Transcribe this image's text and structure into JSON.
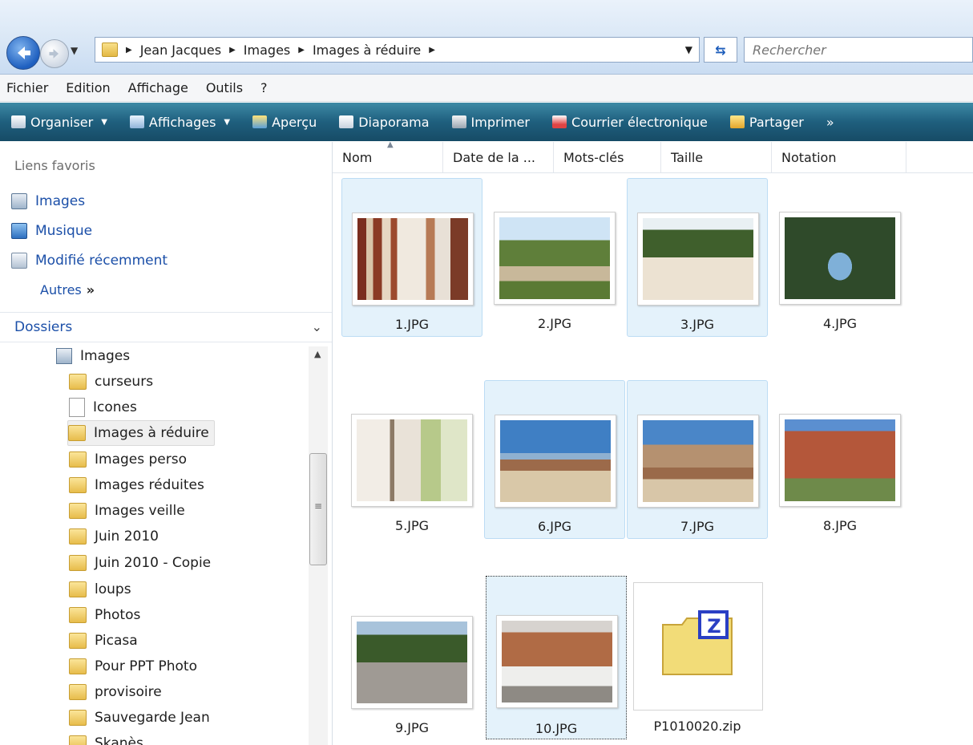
{
  "address": {
    "crumbs": [
      "Jean Jacques",
      "Images",
      "Images à réduire"
    ],
    "search_placeholder": "Rechercher"
  },
  "menu": [
    "Fichier",
    "Edition",
    "Affichage",
    "Outils",
    "?"
  ],
  "toolbar": {
    "organiser": "Organiser",
    "affichages": "Affichages",
    "apercu": "Aperçu",
    "diaporama": "Diaporama",
    "imprimer": "Imprimer",
    "courrier": "Courrier électronique",
    "partager": "Partager",
    "more": "»"
  },
  "favorites": {
    "title": "Liens favoris",
    "items": [
      "Images",
      "Musique",
      "Modifié récemment"
    ],
    "others": "Autres",
    "others_more": "»"
  },
  "folders": {
    "title": "Dossiers",
    "root": "Images",
    "items": [
      "curseurs",
      "Icones",
      "Images à réduire",
      "Images perso",
      "Images réduites",
      "Images veille",
      "Juin 2010",
      "Juin 2010 - Copie",
      "loups",
      "Photos",
      "Picasa",
      "Pour PPT Photo",
      "provisoire",
      "Sauvegarde Jean",
      "Skanès"
    ],
    "selected": "Images à réduire"
  },
  "columns": [
    "Nom",
    "Date de la ...",
    "Mots-clés",
    "Taille",
    "Notation"
  ],
  "files": [
    {
      "name": "1.JPG",
      "selected": true
    },
    {
      "name": "2.JPG",
      "selected": false
    },
    {
      "name": "3.JPG",
      "selected": true
    },
    {
      "name": "4.JPG",
      "selected": false
    },
    {
      "name": "5.JPG",
      "selected": false
    },
    {
      "name": "6.JPG",
      "selected": true
    },
    {
      "name": "7.JPG",
      "selected": true
    },
    {
      "name": "8.JPG",
      "selected": false
    },
    {
      "name": "9.JPG",
      "selected": false
    },
    {
      "name": "10.JPG",
      "selected": true,
      "focused": true
    },
    {
      "name": "P1010020.zip",
      "selected": false
    }
  ],
  "zip_letter": "Z"
}
